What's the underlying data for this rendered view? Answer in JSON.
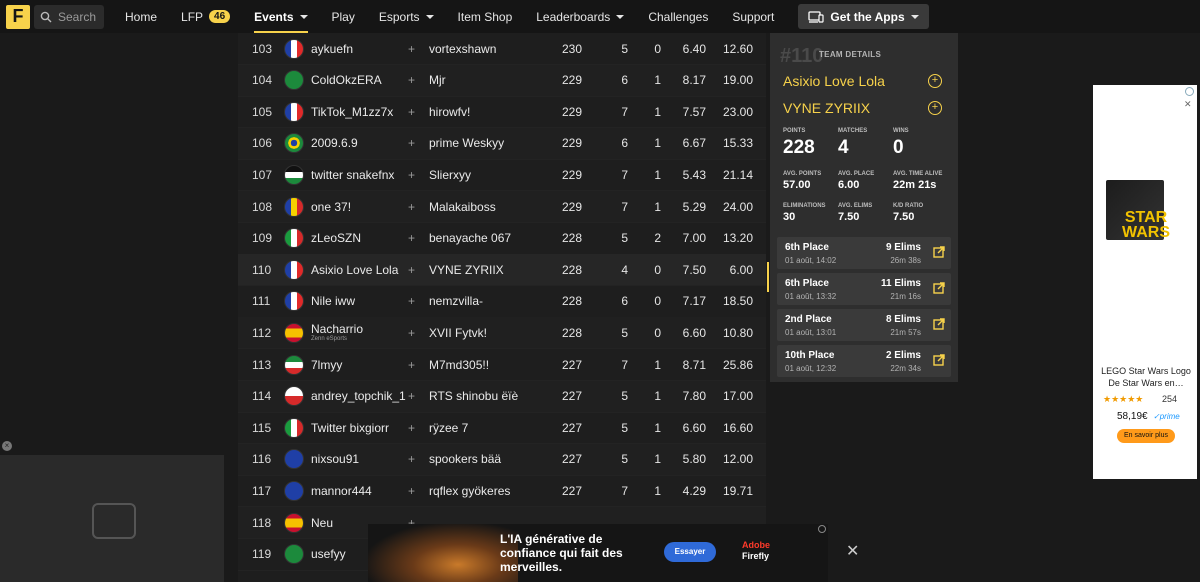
{
  "nav": {
    "logo_letter": "F",
    "search_placeholder": "Search",
    "items": [
      {
        "label": "Home"
      },
      {
        "label": "LFP",
        "badge": "46"
      },
      {
        "label": "Events",
        "active": true,
        "dropdown": true
      },
      {
        "label": "Play"
      },
      {
        "label": "Esports",
        "dropdown": true
      },
      {
        "label": "Item Shop"
      },
      {
        "label": "Leaderboards",
        "dropdown": true
      },
      {
        "label": "Challenges"
      },
      {
        "label": "Support"
      }
    ],
    "apps_label": "Get the Apps",
    "accent": "#f7d24b"
  },
  "leaderboard": {
    "rows": [
      {
        "rank": "103",
        "flag": "france",
        "p1": "aykuefn",
        "p2": "vortexshawn",
        "points": "230",
        "matches": "5",
        "wins": "0",
        "avg_place": "6.40",
        "kd": "12.60"
      },
      {
        "rank": "104",
        "flag": "saudi-arabia",
        "p1": "ColdOkzERA",
        "p2": "Mjr",
        "points": "229",
        "matches": "6",
        "wins": "1",
        "avg_place": "8.17",
        "kd": "19.00"
      },
      {
        "rank": "105",
        "flag": "france",
        "p1": "TikTok_M1zz7x",
        "p2": "hirowfv!",
        "points": "229",
        "matches": "7",
        "wins": "1",
        "avg_place": "7.57",
        "kd": "23.00"
      },
      {
        "rank": "106",
        "flag": "brazil",
        "p1": "2009.6.9",
        "p2": "prime Weskyy",
        "points": "229",
        "matches": "6",
        "wins": "1",
        "avg_place": "6.67",
        "kd": "15.33"
      },
      {
        "rank": "107",
        "flag": "jordan",
        "p1": "twitter snakefnx",
        "p2": "Slierxyy",
        "points": "229",
        "matches": "7",
        "wins": "1",
        "avg_place": "5.43",
        "kd": "21.14"
      },
      {
        "rank": "108",
        "flag": "romania",
        "p1": "one 37!",
        "p2": "Malakaiboss",
        "points": "229",
        "matches": "7",
        "wins": "1",
        "avg_place": "5.29",
        "kd": "24.00"
      },
      {
        "rank": "109",
        "flag": "italy",
        "p1": "zLeoSZN",
        "p2": "benayache 067",
        "points": "228",
        "matches": "5",
        "wins": "2",
        "avg_place": "7.00",
        "kd": "13.20"
      },
      {
        "rank": "110",
        "flag": "france",
        "p1": "Asixio Love Lola",
        "p2": "VYNE ZYRIIX",
        "points": "228",
        "matches": "4",
        "wins": "0",
        "avg_place": "7.50",
        "kd": "6.00",
        "selected": true
      },
      {
        "rank": "111",
        "flag": "france",
        "p1": "Nile iww",
        "p2": "nemzvilla-",
        "points": "228",
        "matches": "6",
        "wins": "0",
        "avg_place": "7.17",
        "kd": "18.50"
      },
      {
        "rank": "112",
        "flag": "spain",
        "p1": "Nacharrio",
        "p1_sub": "Zenn eSports",
        "p2": "XVII Fytvk!",
        "points": "228",
        "matches": "5",
        "wins": "0",
        "avg_place": "6.60",
        "kd": "10.80"
      },
      {
        "rank": "113",
        "flag": "kuwait",
        "p1": "7lmyy",
        "p2": "M7md305!!",
        "points": "227",
        "matches": "7",
        "wins": "1",
        "avg_place": "8.71",
        "kd": "25.86"
      },
      {
        "rank": "114",
        "flag": "poland",
        "p1": "andrey_topchik_1",
        "p2": "RTS shinobu ëïè",
        "points": "227",
        "matches": "5",
        "wins": "1",
        "avg_place": "7.80",
        "kd": "17.00"
      },
      {
        "rank": "115",
        "flag": "italy",
        "p1": "Twitter bixgiorr",
        "p2": "rÿzee 7",
        "points": "227",
        "matches": "5",
        "wins": "1",
        "avg_place": "6.60",
        "kd": "16.60"
      },
      {
        "rank": "116",
        "flag": "uk",
        "p1": "nixsou91",
        "p2": "spookers bää",
        "points": "227",
        "matches": "5",
        "wins": "1",
        "avg_place": "5.80",
        "kd": "12.00"
      },
      {
        "rank": "117",
        "flag": "uk",
        "p1": "mannor444",
        "p2": "rqflex gyökeres",
        "points": "227",
        "matches": "7",
        "wins": "1",
        "avg_place": "4.29",
        "kd": "19.71"
      },
      {
        "rank": "118",
        "flag": "spain",
        "p1": "Neu",
        "p2": "",
        "points": "",
        "matches": "",
        "wins": "",
        "avg_place": "",
        "kd": ""
      },
      {
        "rank": "119",
        "flag": "saudi-arabia",
        "p1": "usefyy",
        "p2": "",
        "points": "",
        "matches": "",
        "wins": "",
        "avg_place": "",
        "kd": ""
      }
    ]
  },
  "team": {
    "number": "#110",
    "label": "TEAM DETAILS",
    "members": [
      "Asixio Love Lola",
      "VYNE ZYRIIX"
    ],
    "stats_big": [
      {
        "label": "POINTS",
        "value": "228"
      },
      {
        "label": "MATCHES",
        "value": "4"
      },
      {
        "label": "WINS",
        "value": "0"
      }
    ],
    "stats_row1": [
      {
        "label": "AVG. POINTS",
        "value": "57.00"
      },
      {
        "label": "AVG. PLACE",
        "value": "6.00"
      },
      {
        "label": "AVG. TIME ALIVE",
        "value": "22m 21s"
      }
    ],
    "stats_row2": [
      {
        "label": "ELIMINATIONS",
        "value": "30"
      },
      {
        "label": "AVG. ELIMS",
        "value": "7.50"
      },
      {
        "label": "K/D RATIO",
        "value": "7.50"
      }
    ],
    "matches": [
      {
        "place": "6th Place",
        "date": "01 août, 14:02",
        "elims": "9 Elims",
        "time": "26m 38s"
      },
      {
        "place": "6th Place",
        "date": "01 août, 13:32",
        "elims": "11 Elims",
        "time": "21m 16s"
      },
      {
        "place": "2nd Place",
        "date": "01 août, 13:01",
        "elims": "8 Elims",
        "time": "21m 57s"
      },
      {
        "place": "10th Place",
        "date": "01 août, 12:32",
        "elims": "2 Elims",
        "time": "22m 34s"
      }
    ]
  },
  "ad_right": {
    "box_text": "STAR WARS",
    "title": "LEGO Star Wars Logo De Star Wars en…",
    "stars": "★★★★★",
    "rating_count": "254",
    "price": "58,19€",
    "prime": "✓prime",
    "button": "En savoir plus"
  },
  "ad_bottom": {
    "headline": "L'IA générative de confiance qui fait des merveilles.",
    "button": "Essayer",
    "brand_line1": "Adobe",
    "brand_line2": "Firefly"
  },
  "video": {
    "close": "×"
  },
  "icons": [
    "search-icon",
    "caret-down-icon",
    "device-icon",
    "plus-icon",
    "circle-plus-icon",
    "external-link-icon",
    "close-icon",
    "info-icon"
  ]
}
